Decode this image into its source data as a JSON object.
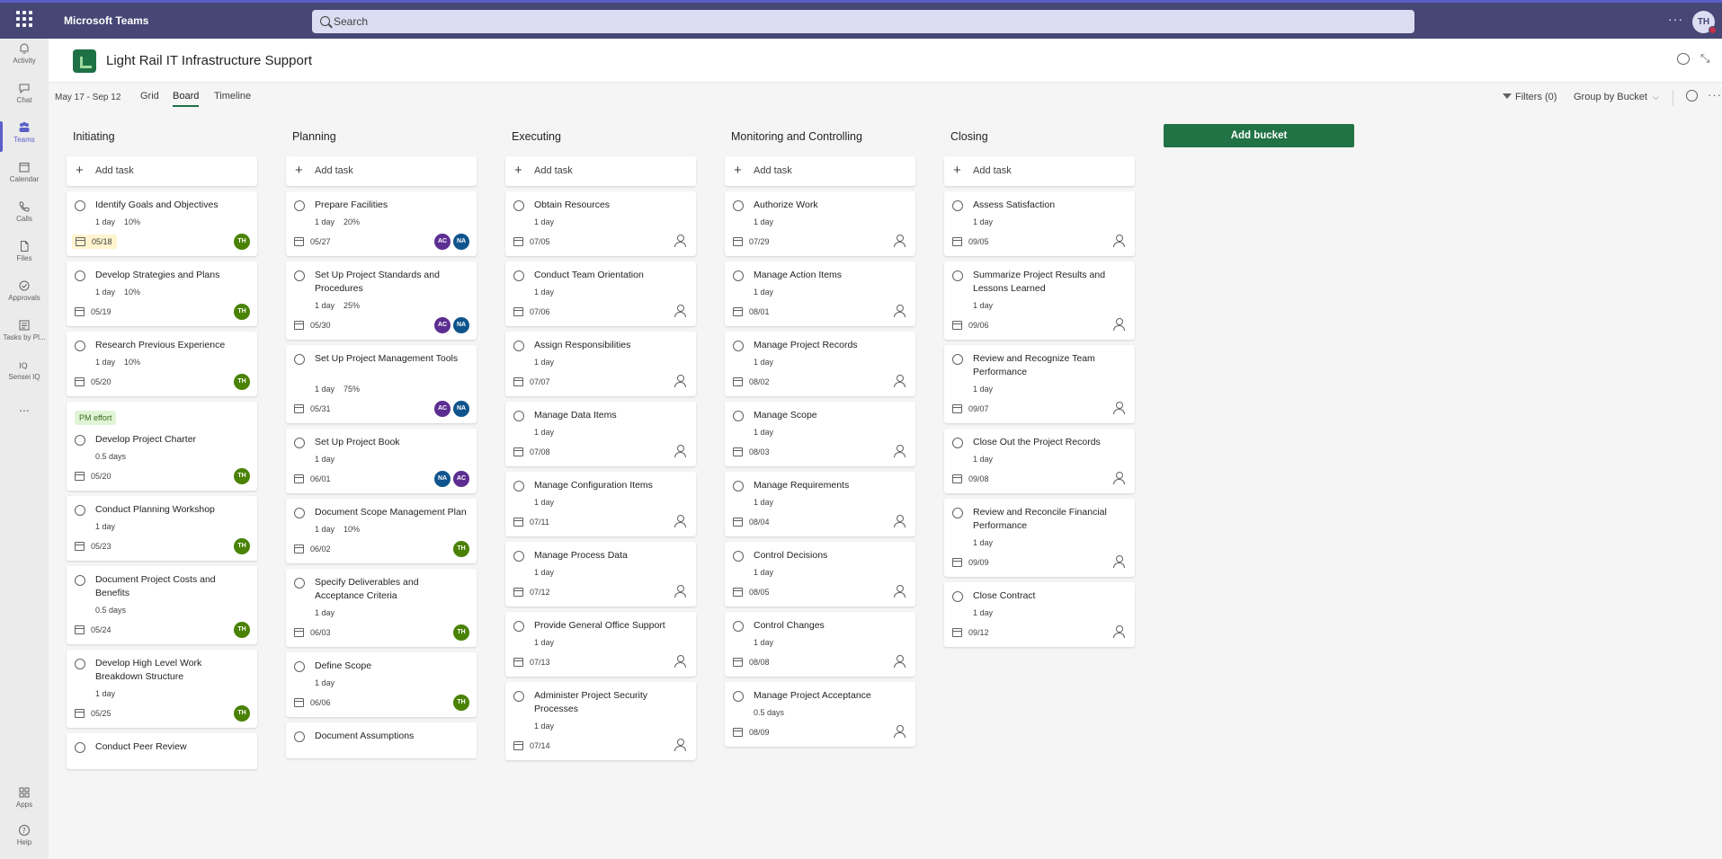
{
  "app": {
    "title": "Microsoft Teams",
    "search_placeholder": "Search",
    "more": "···",
    "user_initials": "TH"
  },
  "rail": [
    {
      "label": "Activity",
      "icon": "bell-icon"
    },
    {
      "label": "Chat",
      "icon": "chat-icon"
    },
    {
      "label": "Teams",
      "icon": "teams-icon",
      "active": true
    },
    {
      "label": "Calendar",
      "icon": "calendar-icon"
    },
    {
      "label": "Calls",
      "icon": "phone-icon"
    },
    {
      "label": "Files",
      "icon": "file-icon"
    },
    {
      "label": "Approvals",
      "icon": "approvals-icon"
    },
    {
      "label": "Tasks by Pl...",
      "icon": "tasks-icon"
    },
    {
      "label": "Sensei IQ",
      "icon": "sensei-iq-icon"
    },
    {
      "label": "...",
      "icon": "more-icon"
    },
    {
      "label": "Apps",
      "icon": "apps-icon"
    },
    {
      "label": "Help",
      "icon": "help-icon"
    }
  ],
  "channel": {
    "title": "Light Rail IT Infrastructure Support"
  },
  "toolbar": {
    "date_range": "May 17 - Sep 12",
    "views": [
      "Grid",
      "Board",
      "Timeline"
    ],
    "active_view": "Board",
    "filters": "Filters (0)",
    "group_by": "Group by Bucket",
    "more": "···"
  },
  "colors": {
    "TH": "#498205",
    "AC": "#5c2e91",
    "NA": "#0f548c",
    "accent": "#464775",
    "planner_green": "#217346"
  },
  "board": {
    "add_task_label": "Add task",
    "add_bucket_label": "Add bucket",
    "buckets": [
      {
        "name": "Initiating",
        "tasks": [
          {
            "title": "Identify Goals and Objectives",
            "duration": "1 day",
            "progress": "10%",
            "date": "05/18",
            "assignees": [
              "TH"
            ],
            "overdue": true
          },
          {
            "title": "Develop Strategies and Plans",
            "duration": "1 day",
            "progress": "10%",
            "date": "05/19",
            "assignees": [
              "TH"
            ]
          },
          {
            "title": "Research Previous Experience",
            "duration": "1 day",
            "progress": "10%",
            "date": "05/20",
            "assignees": [
              "TH"
            ]
          },
          {
            "label": "PM effort",
            "title": "Develop Project Charter",
            "duration": "0.5 days",
            "date": "05/20",
            "assignees": [
              "TH"
            ]
          },
          {
            "title": "Conduct Planning Workshop",
            "duration": "1 day",
            "date": "05/23",
            "assignees": [
              "TH"
            ]
          },
          {
            "title": "Document Project Costs and Benefits",
            "duration": "0.5 days",
            "date": "05/24",
            "assignees": [
              "TH"
            ]
          },
          {
            "title": "Develop High Level Work Breakdown Structure",
            "duration": "1 day",
            "date": "05/25",
            "assignees": [
              "TH"
            ]
          },
          {
            "title": "Conduct Peer Review",
            "duration": "",
            "date": "",
            "assignees": []
          }
        ]
      },
      {
        "name": "Planning",
        "tasks": [
          {
            "title": "Prepare Facilities",
            "duration": "1 day",
            "progress": "20%",
            "date": "05/27",
            "assignees": [
              "AC",
              "NA"
            ]
          },
          {
            "title": "Set Up Project Standards and Procedures",
            "duration": "1 day",
            "progress": "25%",
            "date": "05/30",
            "assignees": [
              "AC",
              "NA"
            ]
          },
          {
            "title": "Set Up Project Management Tools",
            "duration": "1 day",
            "progress": "75%",
            "date": "05/31",
            "assignees": [
              "AC",
              "NA"
            ]
          },
          {
            "title": "Set Up Project Book",
            "duration": "1 day",
            "date": "06/01",
            "assignees": [
              "NA",
              "AC"
            ]
          },
          {
            "title": "Document Scope Management Plan",
            "duration": "1 day",
            "progress": "10%",
            "date": "06/02",
            "assignees": [
              "TH"
            ]
          },
          {
            "title": "Specify Deliverables and Acceptance Criteria",
            "duration": "1 day",
            "date": "06/03",
            "assignees": [
              "TH"
            ]
          },
          {
            "title": "Define Scope",
            "duration": "1 day",
            "date": "06/06",
            "assignees": [
              "TH"
            ]
          },
          {
            "title": "Document Assumptions",
            "duration": "",
            "date": "",
            "assignees": []
          }
        ]
      },
      {
        "name": "Executing",
        "tasks": [
          {
            "title": "Obtain Resources",
            "duration": "1 day",
            "date": "07/05",
            "assignees": []
          },
          {
            "title": "Conduct Team Orientation",
            "duration": "1 day",
            "date": "07/06",
            "assignees": []
          },
          {
            "title": "Assign Responsibilities",
            "duration": "1 day",
            "date": "07/07",
            "assignees": []
          },
          {
            "title": "Manage Data Items",
            "duration": "1 day",
            "date": "07/08",
            "assignees": []
          },
          {
            "title": "Manage Configuration Items",
            "duration": "1 day",
            "date": "07/11",
            "assignees": []
          },
          {
            "title": "Manage Process Data",
            "duration": "1 day",
            "date": "07/12",
            "assignees": []
          },
          {
            "title": "Provide General Office Support",
            "duration": "1 day",
            "date": "07/13",
            "assignees": []
          },
          {
            "title": "Administer Project Security Processes",
            "duration": "1 day",
            "date": "07/14",
            "assignees": []
          }
        ]
      },
      {
        "name": "Monitoring and Controlling",
        "tasks": [
          {
            "title": "Authorize Work",
            "duration": "1 day",
            "date": "07/29",
            "assignees": []
          },
          {
            "title": "Manage Action Items",
            "duration": "1 day",
            "date": "08/01",
            "assignees": []
          },
          {
            "title": "Manage Project Records",
            "duration": "1 day",
            "date": "08/02",
            "assignees": []
          },
          {
            "title": "Manage Scope",
            "duration": "1 day",
            "date": "08/03",
            "assignees": []
          },
          {
            "title": "Manage Requirements",
            "duration": "1 day",
            "date": "08/04",
            "assignees": []
          },
          {
            "title": "Control Decisions",
            "duration": "1 day",
            "date": "08/05",
            "assignees": []
          },
          {
            "title": "Control Changes",
            "duration": "1 day",
            "date": "08/08",
            "assignees": []
          },
          {
            "title": "Manage Project Acceptance",
            "duration": "0.5 days",
            "date": "08/09",
            "assignees": []
          }
        ]
      },
      {
        "name": "Closing",
        "tasks": [
          {
            "title": "Assess Satisfaction",
            "duration": "1 day",
            "date": "09/05",
            "assignees": []
          },
          {
            "title": "Summarize Project Results and Lessons Learned",
            "duration": "1 day",
            "date": "09/06",
            "assignees": []
          },
          {
            "title": "Review and Recognize Team Performance",
            "duration": "1 day",
            "date": "09/07",
            "assignees": []
          },
          {
            "title": "Close Out the Project Records",
            "duration": "1 day",
            "date": "09/08",
            "assignees": []
          },
          {
            "title": "Review and Reconcile Financial Performance",
            "duration": "1 day",
            "date": "09/09",
            "assignees": []
          },
          {
            "title": "Close Contract",
            "duration": "1 day",
            "date": "09/12",
            "assignees": []
          }
        ]
      }
    ]
  }
}
